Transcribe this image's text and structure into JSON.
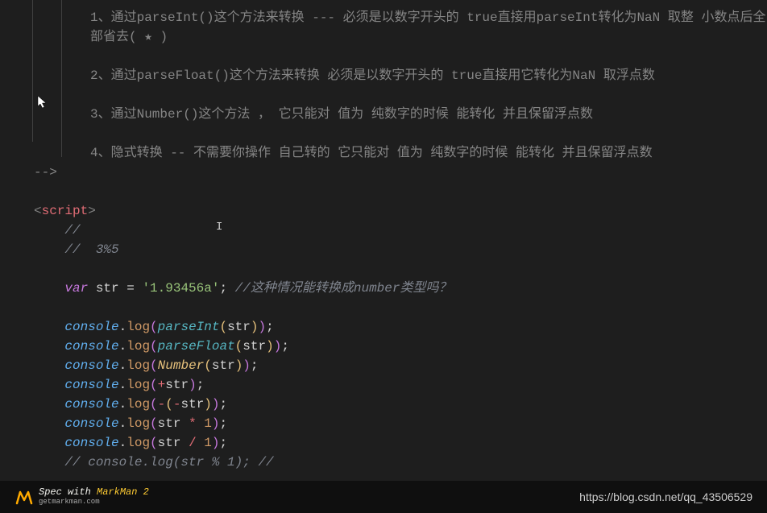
{
  "comments": {
    "line1": "1、通过parseInt()这个方法来转换    ---   必须是以数字开头的   true直接用parseInt转化为NaN 取整  小数点后全部省去( ★ )",
    "line2": "2、通过parseFloat()这个方法来转换   必须是以数字开头的   true直接用它转化为NaN 取浮点数",
    "line3": "3、通过Number()这个方法 ，  它只能对 值为 纯数字的时候 能转化   并且保留浮点数",
    "line4": "4、隐式转换   --   不需要你操作   自己转的 它只能对 值为 纯数字的时候 能转化   并且保留浮点数",
    "close": "-->"
  },
  "code": {
    "scriptOpen": "<script>",
    "scriptOpenTag": "script",
    "c1": "//",
    "c2": "//  3%5",
    "varKw": "var",
    "varName": " str ",
    "eq": "= ",
    "strVal": "'1.93456a'",
    "semi": ";",
    "inlineComment": " //这种情况能转换成number类型吗？",
    "console": "console",
    "dot": ".",
    "log": "log",
    "parseInt": "parseInt",
    "parseFloat": "parseFloat",
    "number": "Number",
    "str": "str",
    "plus": "+",
    "minus": "-",
    "mul": " * ",
    "div": " / ",
    "one": "1",
    "commentedLine": "// console.log(str % 1); //"
  },
  "footer": {
    "titlePrefix": "Spec with ",
    "titleEm": "MarkMan 2",
    "sub": "getmarkman.com",
    "url": "https://blog.csdn.net/qq_43506529"
  },
  "icons": {
    "cursor": "default-cursor-icon",
    "textCursor": "text-cursor-icon",
    "markman": "markman-logo-icon"
  }
}
